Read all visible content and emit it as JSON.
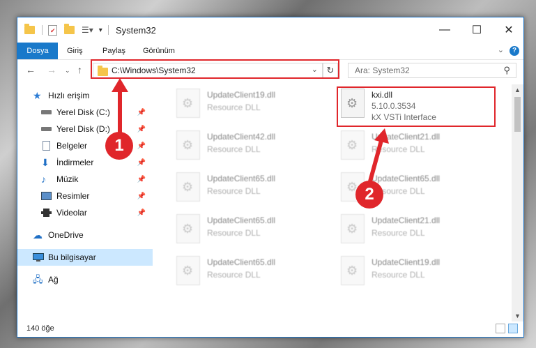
{
  "titlebar": {
    "title": "System32"
  },
  "ribbon": {
    "tabs": [
      "Dosya",
      "Giriş",
      "Paylaş",
      "Görünüm"
    ],
    "help": "?"
  },
  "address": {
    "path": "C:\\Windows\\System32",
    "search_placeholder": "Ara: System32"
  },
  "sidebar": {
    "items": [
      {
        "label": "Hızlı erişim",
        "icon": "star-icon"
      },
      {
        "label": "Yerel Disk (C:)",
        "icon": "drive-icon"
      },
      {
        "label": "Yerel Disk (D:)",
        "icon": "drive-icon"
      },
      {
        "label": "Belgeler",
        "icon": "documents-icon"
      },
      {
        "label": "İndirmeler",
        "icon": "download-icon"
      },
      {
        "label": "Müzik",
        "icon": "music-icon"
      },
      {
        "label": "Resimler",
        "icon": "pictures-icon"
      },
      {
        "label": "Videolar",
        "icon": "videos-icon"
      },
      {
        "label": "OneDrive",
        "icon": "cloud-icon"
      },
      {
        "label": "Bu bilgisayar",
        "icon": "computer-icon"
      },
      {
        "label": "Ağ",
        "icon": "network-icon"
      }
    ]
  },
  "files": {
    "highlighted": {
      "name": "kxi.dll",
      "version": "5.10.0.3534",
      "description": "kX VSTi Interface"
    },
    "left_column": [
      {
        "name": "UpdateClient19.dll",
        "type": "Resource DLL"
      },
      {
        "name": "UpdateClient42.dll",
        "type": "Resource DLL"
      },
      {
        "name": "UpdateClient65.dll",
        "type": "Resource DLL"
      },
      {
        "name": "UpdateClient65.dll",
        "type": "Resource DLL"
      },
      {
        "name": "UpdateClient65.dll",
        "type": "Resource DLL"
      }
    ],
    "right_column": [
      {
        "name": "UpdateClient21.dll",
        "type": "Resource DLL"
      },
      {
        "name": "UpdateClient65.dll",
        "type": "Resource DLL"
      },
      {
        "name": "UpdateClient21.dll",
        "type": "Resource DLL"
      },
      {
        "name": "UpdateClient19.dll",
        "type": "Resource DLL"
      }
    ]
  },
  "status": {
    "count": "140 öğe"
  },
  "annotations": {
    "step1": "1",
    "step2": "2"
  },
  "colors": {
    "accent": "#1979ca",
    "highlight": "#e0262b"
  }
}
